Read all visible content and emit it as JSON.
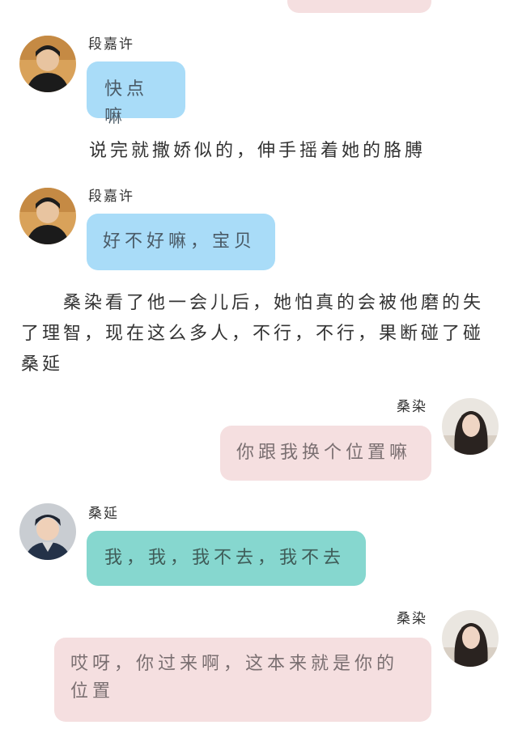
{
  "messages": [
    {
      "speaker": "段嘉许",
      "text": "快点嘛"
    },
    {
      "speaker": "段嘉许",
      "text": "好不好嘛，宝贝"
    },
    {
      "speaker": "桑染",
      "text": "你跟我换个位置嘛"
    },
    {
      "speaker": "桑延",
      "text": "我，我，我不去，我不去"
    },
    {
      "speaker": "桑染",
      "text": "哎呀，你过来啊，这本来就是你的位置"
    }
  ],
  "narration": [
    "说完就撒娇似的，伸手摇着她的胳膊",
    "　　桑染看了他一会儿后，她怕真的会被他磨的失了理智，现在这么多人，不行，不行，果断碰了碰桑延"
  ],
  "colors": {
    "blue_bubble": "#a9dcf8",
    "pink_bubble": "#f5dfe0",
    "teal_bubble": "#86d7cf"
  }
}
